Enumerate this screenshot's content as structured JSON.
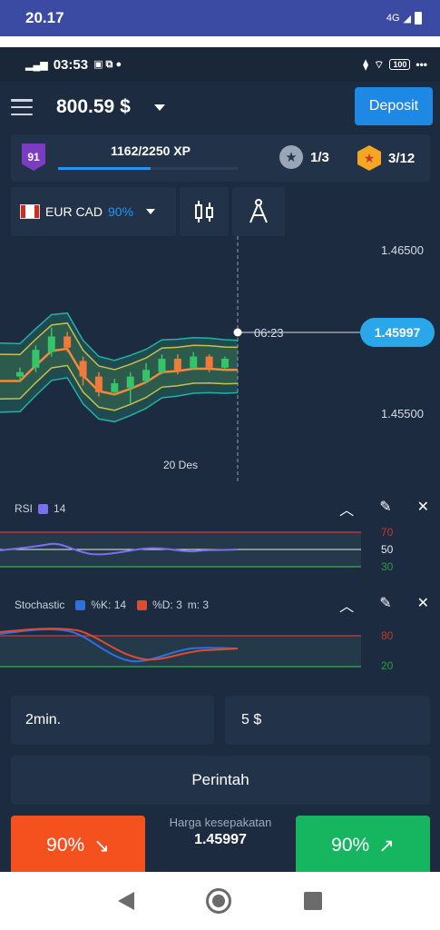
{
  "outer_status": {
    "time": "20.17",
    "network": "4G"
  },
  "inner_status": {
    "time": "03:53",
    "battery": "100"
  },
  "header": {
    "balance": "800.59 $",
    "deposit_label": "Deposit"
  },
  "xp": {
    "level": "91",
    "progress_text": "1162/2250 XP",
    "progress": 0.516,
    "stars": "1/3",
    "achievements": "3/12"
  },
  "toolbar": {
    "pair": "EUR CAD",
    "payout": "90%"
  },
  "chart": {
    "current_price": "1.45997",
    "timer": "06:23",
    "date_label": "20 Des",
    "y_ticks": [
      "1.46500",
      "1.45500"
    ]
  },
  "chart_data": {
    "type": "candlestick",
    "title": "",
    "xlabel": "20 Des",
    "ylabel": "",
    "ylim": [
      1.4545,
      1.4655
    ],
    "series": [
      {
        "type": "candles",
        "values": [
          {
            "o": 1.4592,
            "c": 1.4594,
            "h": 1.4596,
            "l": 1.459
          },
          {
            "o": 1.4596,
            "c": 1.4604,
            "h": 1.4606,
            "l": 1.4594
          },
          {
            "o": 1.4603,
            "c": 1.461,
            "h": 1.4614,
            "l": 1.4601
          },
          {
            "o": 1.461,
            "c": 1.4605,
            "h": 1.4612,
            "l": 1.4603
          },
          {
            "o": 1.4599,
            "c": 1.4592,
            "h": 1.4601,
            "l": 1.4588
          },
          {
            "o": 1.4592,
            "c": 1.4585,
            "h": 1.4594,
            "l": 1.4583
          },
          {
            "o": 1.4585,
            "c": 1.4589,
            "h": 1.4591,
            "l": 1.4584
          },
          {
            "o": 1.4587,
            "c": 1.4592,
            "h": 1.4594,
            "l": 1.458
          },
          {
            "o": 1.459,
            "c": 1.4595,
            "h": 1.4598,
            "l": 1.4589
          },
          {
            "o": 1.4594,
            "c": 1.46,
            "h": 1.4602,
            "l": 1.4593
          },
          {
            "o": 1.46,
            "c": 1.4595,
            "h": 1.4602,
            "l": 1.4593
          },
          {
            "o": 1.4596,
            "c": 1.4601,
            "h": 1.4603,
            "l": 1.4595
          },
          {
            "o": 1.4601,
            "c": 1.4596,
            "h": 1.4602,
            "l": 1.4594
          },
          {
            "o": 1.4596,
            "c": 1.46,
            "h": 1.4601,
            "l": 1.4595
          }
        ]
      }
    ]
  },
  "rsi": {
    "name": "RSI",
    "period": "14",
    "levels": [
      "70",
      "50",
      "30"
    ]
  },
  "stochastic": {
    "name": "Stochastic",
    "k_label": "%K: 14",
    "d_label": "%D: 3",
    "m_label": "m: 3",
    "levels": [
      "80",
      "20"
    ]
  },
  "trade": {
    "duration": "2min.",
    "amount": "5 $",
    "order_label": "Perintah",
    "down_pct": "90%",
    "up_pct": "90%",
    "deal_label": "Harga kesepakatan",
    "deal_price": "1.45997"
  },
  "colors": {
    "down": "#f4511e",
    "up": "#16b560",
    "accent": "#2196f3",
    "background": "#1c2b3f"
  }
}
